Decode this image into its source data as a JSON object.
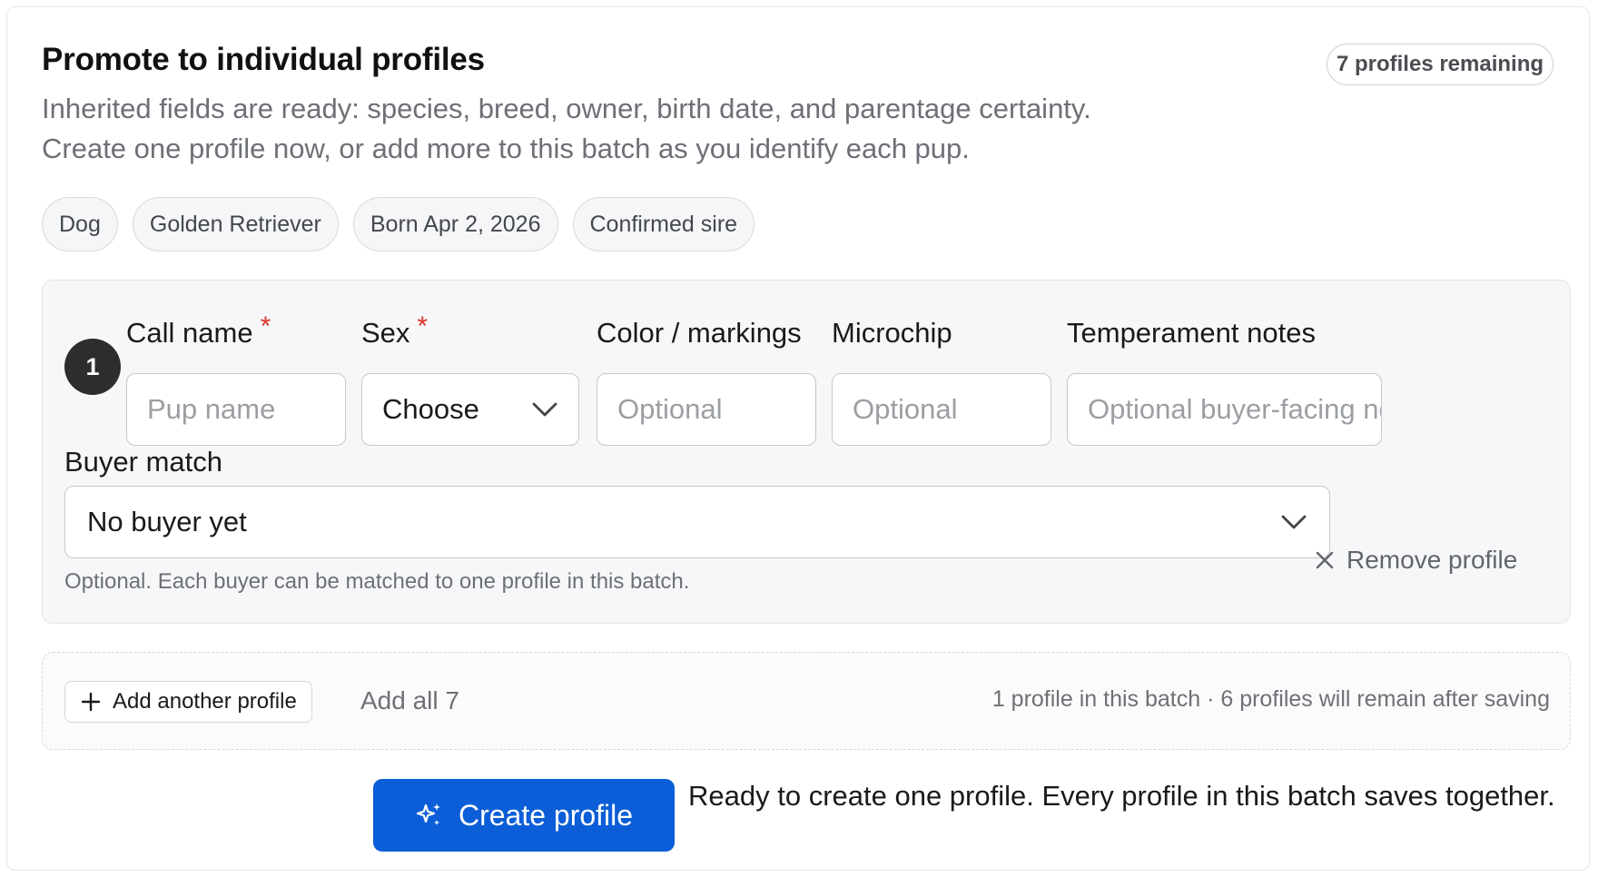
{
  "header": {
    "title": "Promote to individual profiles",
    "subtitle": "Inherited fields are ready: species, breed, owner, birth date, and parentage certainty. Create one profile now, or add more to this batch as you identify each pup.",
    "remaining_badge": "7 profiles remaining"
  },
  "chips": [
    "Dog",
    "Golden Retriever",
    "Born Apr 2, 2026",
    "Confirmed sire"
  ],
  "profile": {
    "number": "1",
    "fields": {
      "call_name": {
        "label": "Call name",
        "required_mark": "*",
        "placeholder": "Pup name"
      },
      "sex": {
        "label": "Sex",
        "required_mark": "*",
        "value": "Choose"
      },
      "color": {
        "label": "Color / markings",
        "placeholder": "Optional"
      },
      "microchip": {
        "label": "Microchip",
        "placeholder": "Optional"
      },
      "temperament": {
        "label": "Temperament notes",
        "placeholder": "Optional buyer-facing notes"
      }
    },
    "buyer": {
      "label": "Buyer match",
      "value": "No buyer yet",
      "help": "Optional. Each buyer can be matched to one profile in this batch."
    },
    "remove_label": "Remove profile"
  },
  "batch": {
    "add_another_label": "Add another profile",
    "add_all_label": "Add all 7",
    "status": "1 profile in this batch · 6 profiles will remain after saving"
  },
  "footer": {
    "create_label": "Create profile",
    "ready_text": "Ready to create one profile. Every profile in this batch saves together."
  },
  "colors": {
    "primary": "#0b5ed7",
    "required": "#e0352b",
    "step_badge": "#2d2d2b"
  }
}
